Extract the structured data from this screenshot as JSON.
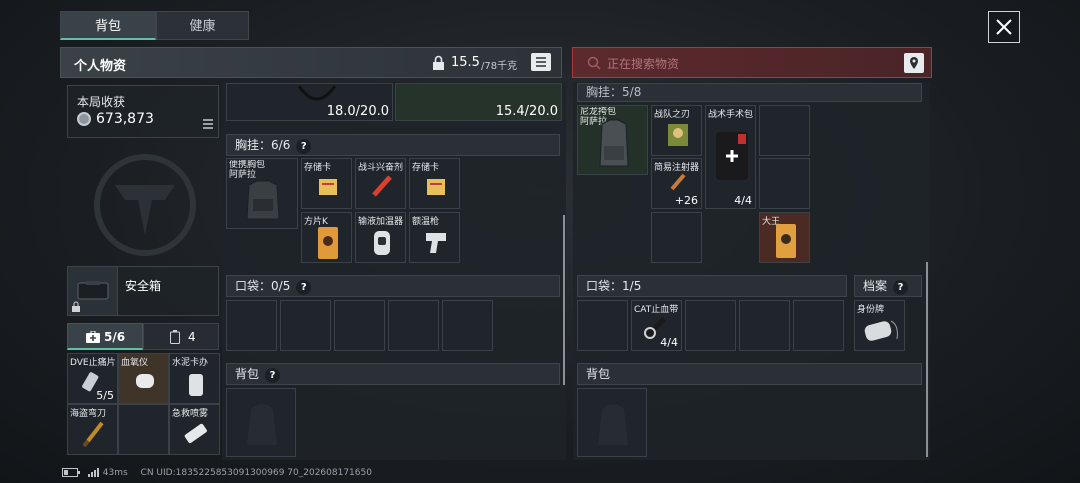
{
  "tabs": [
    {
      "label": "背包",
      "active": true
    },
    {
      "label": "健康",
      "active": false
    }
  ],
  "left_header": {
    "title": "个人物资",
    "weight_value": "15.5",
    "weight_max": "/78千克"
  },
  "summary": {
    "label": "本局收获",
    "value": "673,873"
  },
  "safebox": {
    "label": "安全箱"
  },
  "side_tabs": [
    {
      "label": "5/6",
      "icon": "medkit-icon"
    },
    {
      "label": "4",
      "icon": "canister-icon"
    }
  ],
  "side_items": [
    {
      "label": "DVE止痛片",
      "count": "5/5"
    },
    {
      "label": "血氧仪",
      "count": ""
    },
    {
      "label": "水泥卡办",
      "count": ""
    },
    {
      "label": "海盗弯刀",
      "count": ""
    },
    {
      "label": "",
      "count": ""
    },
    {
      "label": "急救喷雾",
      "count": ""
    }
  ],
  "top_slots": [
    {
      "value": "18.0/20.0"
    },
    {
      "value": "15.4/20.0"
    }
  ],
  "left_rig": {
    "title": "胸挂：",
    "count": "6/6",
    "main_item": "便携胸包\n阿萨拉",
    "items": [
      "存储卡",
      "战斗兴奋剂",
      "存储卡",
      "方片K",
      "输液加温器",
      "额温枪"
    ]
  },
  "left_pocket": {
    "title": "口袋：",
    "count": "0/5"
  },
  "left_backpack": {
    "title": "背包"
  },
  "search": {
    "placeholder": "正在搜索物资"
  },
  "right_rig": {
    "title": "胸挂：",
    "count": "5/8",
    "main_item": "尼龙挎包\n阿萨拉",
    "items": [
      {
        "label": "战队之刃",
        "count": ""
      },
      {
        "label": "战术手术包",
        "count": "4/4"
      },
      {
        "label": "简易注射器",
        "count": "+26"
      },
      {
        "label": "大王",
        "count": ""
      }
    ]
  },
  "right_pocket": {
    "title": "口袋：",
    "count": "1/5",
    "item": {
      "label": "CAT止血带",
      "count": "4/4"
    }
  },
  "archive": {
    "title": "档案",
    "item": "身份牌"
  },
  "right_backpack": {
    "title": "背包"
  },
  "status": {
    "ping": "43ms",
    "uid": "CN UID:1835225853091300969 70_202608171650"
  },
  "colors": {
    "accent_red": "#a83a3e",
    "accent_teal": "#2e8c74"
  }
}
